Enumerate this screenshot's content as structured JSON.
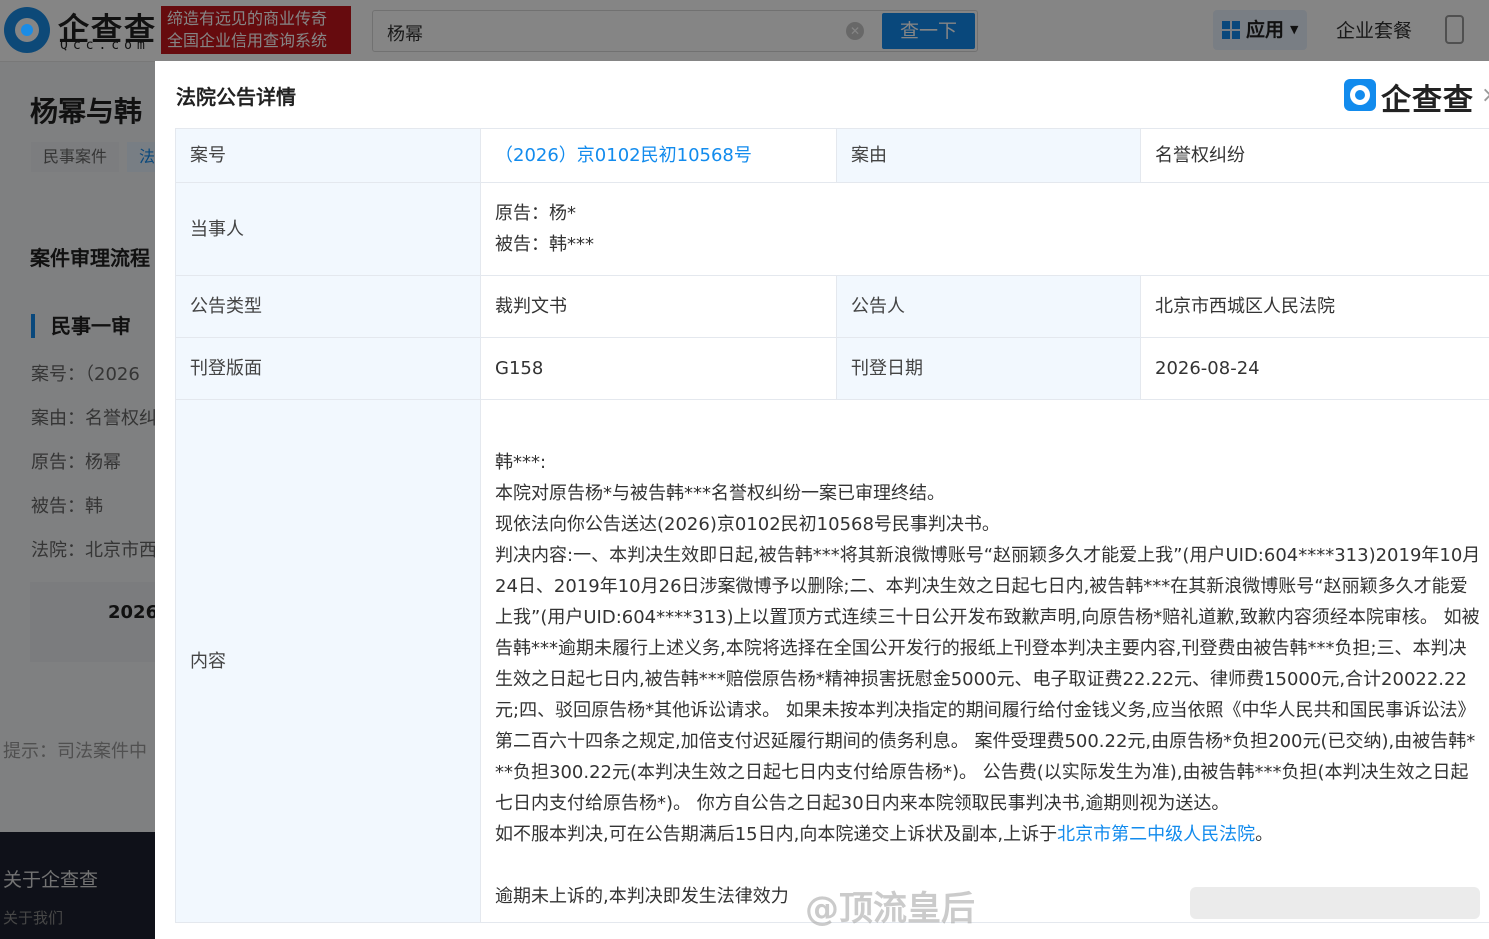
{
  "header": {
    "brand_cn": "企查查",
    "brand_en": "Qcc.com",
    "slogan_line1": "缔造有远见的商业传奇",
    "slogan_line2": "全国企业信用查询系统",
    "search_value": "杨幂",
    "search_button": "查一下",
    "apps_label": "应用",
    "package_label": "企业套餐"
  },
  "background": {
    "title": "杨幂与韩",
    "tag1": "民事案件",
    "tag2": "法",
    "section_title": "案件审理流程",
    "stage": "民事一审",
    "rows": [
      "案号：（2026",
      "案由：名誉权纠",
      "原告：杨幂",
      "被告：韩",
      "法院：北京市西"
    ],
    "date": "2026-",
    "tip": "提示：司法案件中",
    "footer_about": "关于企查查",
    "footer_us": "关于我们"
  },
  "modal": {
    "title": "法院公告详情",
    "brand": "企查查",
    "labels": {
      "case_no": "案号",
      "cause": "案由",
      "parties": "当事人",
      "notice_type": "公告类型",
      "announcer": "公告人",
      "page": "刊登版面",
      "pub_date": "刊登日期",
      "content": "内容"
    },
    "values": {
      "case_no": "（2026）京0102民初10568号",
      "cause": "名誉权纠纷",
      "plaintiff": "原告：杨*",
      "defendant": "被告：韩***",
      "notice_type": "裁判文书",
      "announcer": "北京市西城区人民法院",
      "page": "G158",
      "pub_date": "2026-08-24"
    },
    "content": {
      "salutation": "韩***:",
      "line1": "本院对原告杨*与被告韩***名誉权纠纷一案已审理终结。",
      "line2": "现依法向你公告送达(2026)京0102民初10568号民事判决书。",
      "line3": "判决内容:一、本判决生效即日起,被告韩***将其新浪微博账号“赵丽颖多久才能爱上我”(用户UID:604****313)2019年10月24日、2019年10月26日涉案微博予以删除;二、本判决生效之日起七日内,被告韩***在其新浪微博账号“赵丽颖多久才能爱上我”(用户UID:604****313)上以置顶方式连续三十日公开发布致歉声明,向原告杨*赔礼道歉,致歉内容须经本院审核。 如被告韩***逾期未履行上述义务,本院将选择在全国公开发行的报纸上刊登本判决主要内容,刊登费由被告韩***负担;三、本判决生效之日起七日内,被告韩***赔偿原告杨*精神损害抚慰金5000元、电子取证费22.22元、律师费15000元,合计20022.22元;四、驳回原告杨*其他诉讼请求。 如果未按本判决指定的期间履行给付金钱义务,应当依照《中华人民共和国民事诉讼法》第二百六十四条之规定,加倍支付迟延履行期间的债务利息。 案件受理费500.22元,由原告杨*负担200元(已交纳),由被告韩***负担300.22元(本判决生效之日起七日内支付给原告杨*)。 公告费(以实际发生为准),由被告韩***负担(本判决生效之日起七日内支付给原告杨*)。 你方自公告之日起30日内来本院领取民事判决书,逾期则视为送达。",
      "line4_prefix": "如不服本判决,可在公告期满后15日内,向本院递交上诉状及副本,上诉于",
      "line4_link": "北京市第二中级人民法院",
      "line4_suffix": "。",
      "line5": "逾期未上诉的,本判决即发生法律效力"
    },
    "watermark": "@顶流皇后"
  }
}
